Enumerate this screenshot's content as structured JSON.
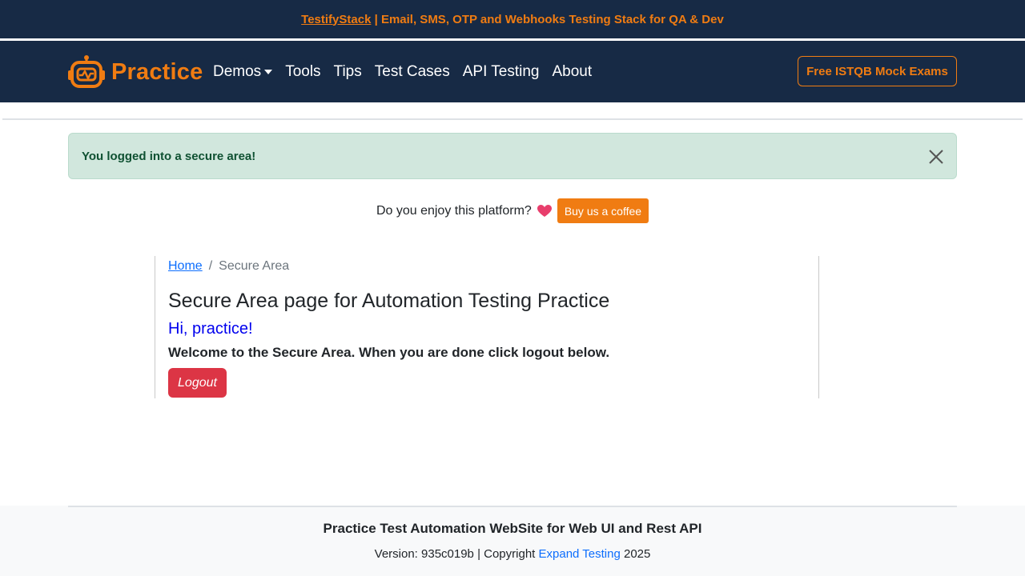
{
  "topbar": {
    "link": "TestifyStack",
    "text": " | Email, SMS, OTP and Webhooks Testing Stack for QA & Dev"
  },
  "navbar": {
    "brand": "Practice",
    "items": [
      {
        "label": "Demos"
      },
      {
        "label": "Tools"
      },
      {
        "label": "Tips"
      },
      {
        "label": "Test Cases"
      },
      {
        "label": "API Testing"
      },
      {
        "label": "About"
      }
    ],
    "cta": "Free ISTQB Mock Exams"
  },
  "alert": {
    "message": "You logged into a secure area!"
  },
  "coffee": {
    "question": "Do you enjoy this platform?",
    "button": "Buy us a coffee"
  },
  "breadcrumb": {
    "home": "Home",
    "separator": "/",
    "current": "Secure Area"
  },
  "main": {
    "title": "Secure Area page for Automation Testing Practice",
    "greeting": "Hi, practice!",
    "welcome": "Welcome to the Secure Area. When you are done click logout below.",
    "logout": "Logout"
  },
  "footer": {
    "title": "Practice Test Automation WebSite for Web UI and Rest API",
    "version_prefix": "Version: 935c019b | Copyright ",
    "company": "Expand Testing",
    "year": " 2025"
  },
  "colors": {
    "navy": "#172a45",
    "orange": "#f07c12",
    "success_bg": "#d1e7dd",
    "success_text": "#0f5132",
    "danger": "#dc3545",
    "link": "#0d6efd"
  },
  "icons": {
    "brand": "robot-logo-icon",
    "dropdown": "caret-down-icon",
    "close": "close-icon",
    "heart": "heart-icon"
  }
}
